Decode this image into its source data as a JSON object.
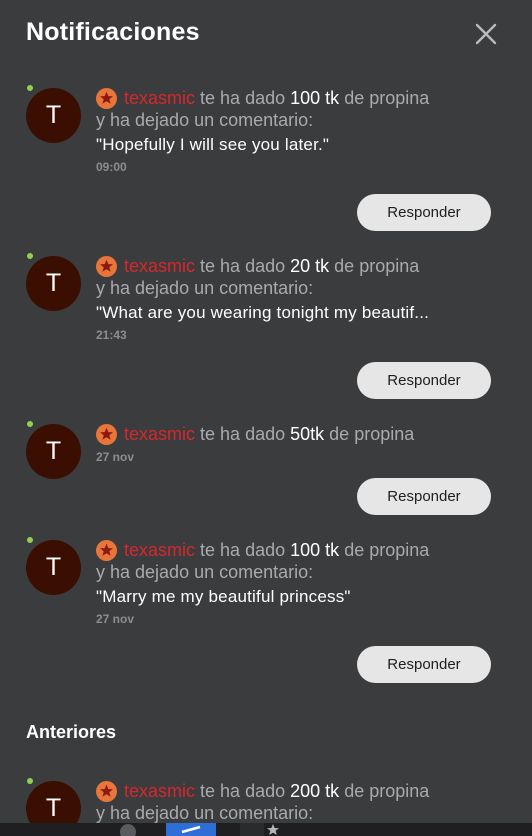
{
  "header": {
    "title": "Notificaciones",
    "close_icon": "close-icon"
  },
  "notifications": [
    {
      "avatar_letter": "T",
      "username": "texasmic",
      "text_before": "te ha dado",
      "amount": "100 tk",
      "text_after": "de propina",
      "line2": "y ha dejado un comentario:",
      "comment": "\"Hopefully I will see you later.\"",
      "time": "09:00",
      "reply_label": "Responder"
    },
    {
      "avatar_letter": "T",
      "username": "texasmic",
      "text_before": "te ha dado",
      "amount": "20 tk",
      "text_after": "de propina",
      "line2": "y ha dejado un comentario:",
      "comment": "\"What are you wearing tonight my beautif...",
      "time": "21:43",
      "reply_label": "Responder"
    },
    {
      "avatar_letter": "T",
      "username": "texasmic",
      "text_before": "te ha dado",
      "amount": "50tk",
      "text_after": "de propina",
      "time": "27 nov",
      "reply_label": "Responder"
    },
    {
      "avatar_letter": "T",
      "username": "texasmic",
      "text_before": "te ha dado",
      "amount": "100 tk",
      "text_after": "de propina",
      "line2": "y ha dejado un comentario:",
      "comment": "\"Marry me my beautiful princess\"",
      "time": "27 nov",
      "reply_label": "Responder"
    }
  ],
  "previous": {
    "heading": "Anteriores",
    "items": [
      {
        "avatar_letter": "T",
        "username": "texasmic",
        "text_before": "te ha dado",
        "amount": "200 tk",
        "text_after": "de propina",
        "line2": "y ha dejado un comentario:"
      }
    ]
  },
  "colors": {
    "background": "#3b3c3e",
    "username": "#d6282c",
    "avatar": "#3a0f02",
    "online": "#8fd14f",
    "badge": "#e8763a",
    "button": "#e6e6e6"
  }
}
